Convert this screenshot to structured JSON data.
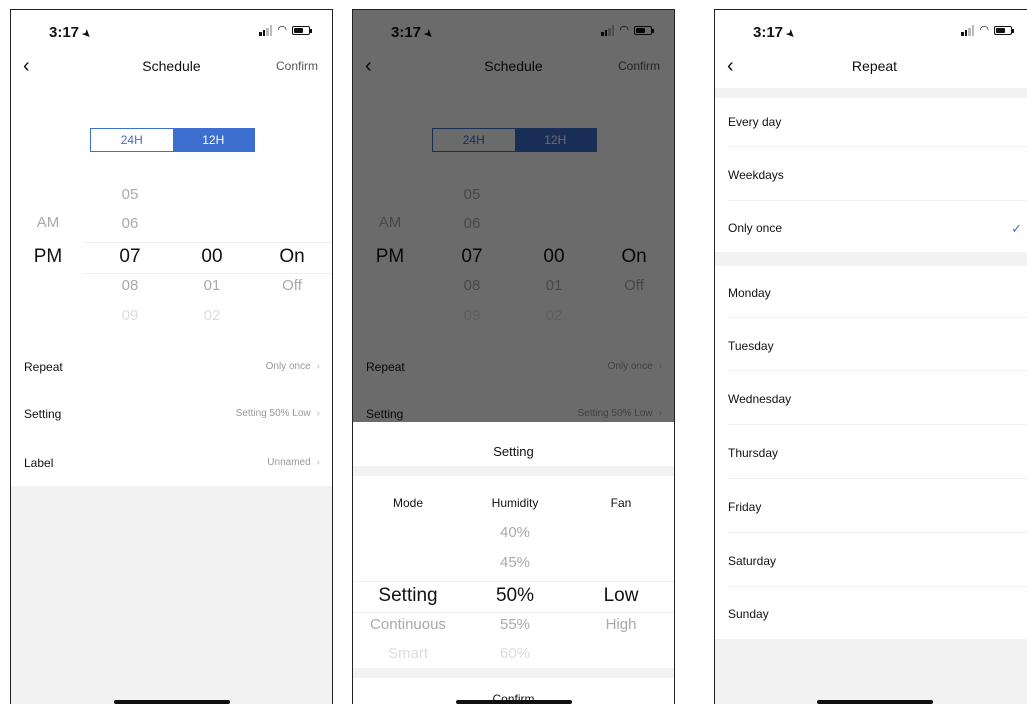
{
  "status": {
    "time": "3:17"
  },
  "schedule": {
    "title": "Schedule",
    "confirm": "Confirm",
    "format_24h": "24H",
    "format_12h": "12H",
    "picker": {
      "ampm": [
        "AM",
        "PM"
      ],
      "hours": [
        "05",
        "06",
        "07",
        "08",
        "09"
      ],
      "minutes": [
        "00",
        "01",
        "02"
      ],
      "onoff": [
        "On",
        "Off"
      ]
    },
    "rows": [
      {
        "label": "Repeat",
        "value": "Only once"
      },
      {
        "label": "Setting",
        "value": "Setting 50% Low"
      },
      {
        "label": "Label",
        "value": "Unnamed"
      }
    ]
  },
  "setting_sheet": {
    "title": "Setting",
    "headers": {
      "mode": "Mode",
      "humidity": "Humidity",
      "fan": "Fan"
    },
    "mode": [
      "Setting",
      "Continuous",
      "Smart"
    ],
    "humidity": [
      "40%",
      "45%",
      "50%",
      "55%",
      "60%"
    ],
    "fan": [
      "Low",
      "High"
    ],
    "confirm": "Confirm"
  },
  "repeat": {
    "title": "Repeat",
    "options": [
      "Every day",
      "Weekdays",
      "Only once"
    ],
    "days": [
      "Monday",
      "Tuesday",
      "Wednesday",
      "Thursday",
      "Friday",
      "Saturday",
      "Sunday"
    ]
  },
  "icons": {
    "back": "chevron-left-icon",
    "check": "checkmark-icon",
    "chevron": "chevron-right-icon"
  },
  "colors": {
    "accent": "#3d6fd0"
  }
}
